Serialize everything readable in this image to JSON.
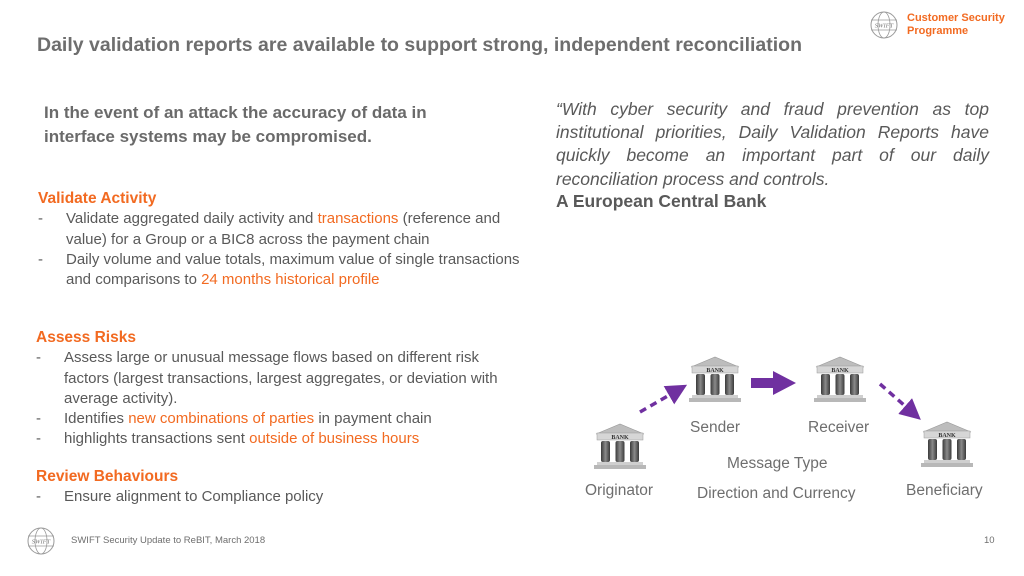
{
  "header": {
    "title": "Daily validation reports are available to support strong, independent reconciliation",
    "brand_line1": "Customer Security",
    "brand_line2": "Programme",
    "logo_icon": "swift-globe-icon"
  },
  "lead": "In the event of an attack the accuracy of data in interface systems may be compromised.",
  "sections": [
    {
      "title": "Validate Activity",
      "bullets": [
        {
          "parts": [
            {
              "text": "Validate aggregated daily activity and ",
              "hl": false
            },
            {
              "text": "transactions",
              "hl": true
            },
            {
              "text": " (reference and value) for a Group or a BIC8 across the payment chain",
              "hl": false
            }
          ]
        },
        {
          "parts": [
            {
              "text": "Daily volume and value totals, maximum value of single transactions and comparisons to ",
              "hl": false
            },
            {
              "text": "24 months historical profile",
              "hl": true
            }
          ]
        }
      ]
    },
    {
      "title": "Assess Risks",
      "bullets": [
        {
          "parts": [
            {
              "text": "Assess large or unusual message flows based on different risk factors (largest transactions, largest aggregates, or deviation with average activity).",
              "hl": false
            }
          ]
        },
        {
          "parts": [
            {
              "text": "Identifies ",
              "hl": false
            },
            {
              "text": "new combinations of parties",
              "hl": true
            },
            {
              "text": " in payment chain",
              "hl": false
            }
          ]
        },
        {
          "parts": [
            {
              "text": "highlights transactions sent ",
              "hl": false
            },
            {
              "text": "outside of business hours",
              "hl": true
            }
          ]
        }
      ]
    },
    {
      "title": "Review Behaviours",
      "bullets": [
        {
          "parts": [
            {
              "text": "Ensure alignment to Compliance policy",
              "hl": false
            }
          ]
        }
      ]
    }
  ],
  "bullet_marker": "-",
  "quote": {
    "text": "“With cyber security and fraud prevention as top institutional priorities, Daily Validation Reports have quickly become an important part of our daily reconciliation process and controls.",
    "attribution": "A European Central Bank"
  },
  "diagram": {
    "bank_label": "BANK",
    "nodes": {
      "originator": "Originator",
      "sender": "Sender",
      "receiver": "Receiver",
      "beneficiary": "Beneficiary"
    },
    "center_line1": "Message Type",
    "center_line2": "Direction and Currency",
    "arrow_color": "#7030a0"
  },
  "footer": {
    "text": "SWIFT Security Update to ReBIT, March 2018",
    "page": "10"
  }
}
